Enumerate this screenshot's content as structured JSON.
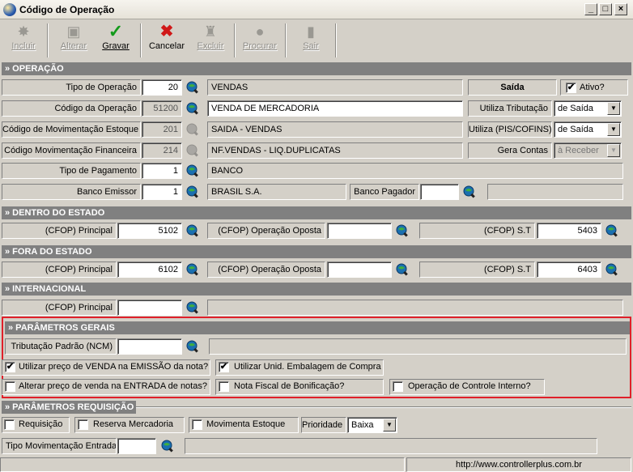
{
  "window": {
    "title": "Código de Operação",
    "controls": [
      "_",
      "□",
      "×"
    ]
  },
  "toolbar": {
    "incluir": "Incluir",
    "alterar": "Alterar",
    "gravar": "Gravar",
    "cancelar": "Cancelar",
    "excluir": "Excluir",
    "procurar": "Procurar",
    "sair": "Sair"
  },
  "sections": {
    "operacao": "» OPERAÇÃO",
    "dentro": "» DENTRO DO ESTADO",
    "fora": "» FORA DO ESTADO",
    "internacional": "» INTERNACIONAL",
    "parametros_gerais": "» PARÂMETROS GERAIS",
    "parametros_requisicao": "» PARÂMETROS REQUISIÇÃO"
  },
  "operacao": {
    "tipo_operacao_label": "Tipo de Operação",
    "tipo_operacao_value": "20",
    "tipo_operacao_desc": "VENDAS",
    "saida_label": "Saída",
    "ativo_label": "Ativo?",
    "ativo_checked": "✔",
    "codigo_operacao_label": "Código da Operação",
    "codigo_operacao_value": "51200",
    "codigo_operacao_desc": "VENDA DE MERCADORIA",
    "utiliza_tributacao_label": "Utiliza Tributação",
    "utiliza_tributacao_value": "de Saída",
    "mov_estoque_label": "Código de Movimentação Estoque",
    "mov_estoque_value": "201",
    "mov_estoque_desc": "SAIDA - VENDAS",
    "utiliza_pis_label": "Utiliza (PIS/COFINS)",
    "utiliza_pis_value": "de Saída",
    "mov_financeira_label": "Código Movimentação Financeira",
    "mov_financeira_value": "214",
    "mov_financeira_desc": "NF.VENDAS - LIQ.DUPLICATAS",
    "gera_contas_label": "Gera Contas",
    "gera_contas_value": "à Receber",
    "tipo_pagamento_label": "Tipo de Pagamento",
    "tipo_pagamento_value": "1",
    "tipo_pagamento_desc": "BANCO",
    "banco_emissor_label": "Banco Emissor",
    "banco_emissor_value": "1",
    "banco_emissor_desc": "BRASIL S.A.",
    "banco_pagador_label": "Banco Pagador",
    "banco_pagador_value": ""
  },
  "dentro": {
    "principal_label": "(CFOP) Principal",
    "principal_value": "5102",
    "oposta_label": "(CFOP) Operação Oposta",
    "oposta_value": "",
    "st_label": "(CFOP) S.T",
    "st_value": "5403"
  },
  "fora": {
    "principal_label": "(CFOP) Principal",
    "principal_value": "6102",
    "oposta_label": "(CFOP) Operação Oposta",
    "oposta_value": "",
    "st_label": "(CFOP) S.T",
    "st_value": "6403"
  },
  "internacional": {
    "principal_label": "(CFOP) Principal",
    "principal_value": ""
  },
  "parametros_gerais": {
    "tributacao_label": "Tributação Padrão (NCM)",
    "tributacao_value": "",
    "utilizar_preco_label": "Utilizar preço de VENDA na EMISSÃO da nota?",
    "utilizar_preco_checked": "✔",
    "utilizar_unid_label": "Utilizar Unid. Embalagem de Compra",
    "utilizar_unid_checked": "✔",
    "alterar_preco_label": "Alterar preço de venda na ENTRADA de notas?",
    "nota_bonificacao_label": "Nota Fiscal de Bonificação?",
    "controle_interno_label": "Operação de Controle Interno?"
  },
  "parametros_requisicao": {
    "requisicao_label": "Requisição",
    "reserva_label": "Reserva Mercadoria",
    "movimenta_label": "Movimenta Estoque",
    "prioridade_label": "Prioridade",
    "prioridade_value": "Baixa",
    "tipo_mov_label": "Tipo Movimentação Entrada",
    "tipo_mov_value": ""
  },
  "status": {
    "url": "http://www.controllerplus.com.br"
  }
}
